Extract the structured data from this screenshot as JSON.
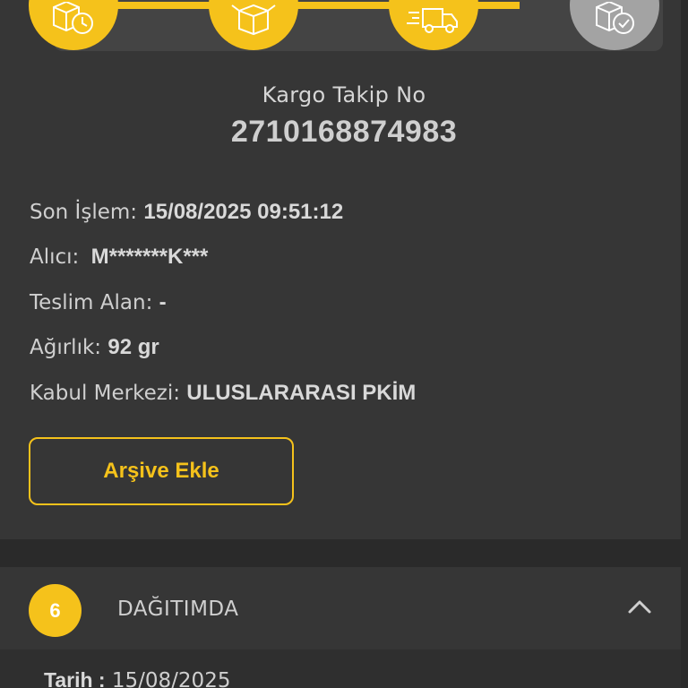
{
  "progress": {
    "steps": [
      {
        "icon": "box-clock-icon",
        "state": "done"
      },
      {
        "icon": "open-box-icon",
        "state": "done"
      },
      {
        "icon": "delivery-truck-icon",
        "state": "done"
      },
      {
        "icon": "box-check-icon",
        "state": "pending"
      }
    ],
    "accent_color": "#f5c21b",
    "pending_color": "#a3a3a3"
  },
  "tracking": {
    "label": "Kargo Takip No",
    "number": "2710168874983"
  },
  "details": {
    "last_action_label": "Son İşlem:",
    "last_action_value": "15/08/2025 09:51:12",
    "recipient_label": "Alıcı:",
    "recipient_value": "M*******K***",
    "received_by_label": "Teslim Alan:",
    "received_by_value": "-",
    "weight_label": "Ağırlık:",
    "weight_value": "92 gr",
    "acceptance_center_label": "Kabul Merkezi:",
    "acceptance_center_value": "ULUSLARARASI PKİM"
  },
  "archive_button": {
    "label": "Arşive Ekle"
  },
  "status": {
    "step_number": "6",
    "title": "DAĞITIMDA",
    "date_label": "Tarih :",
    "date_value": "15/08/2025"
  }
}
